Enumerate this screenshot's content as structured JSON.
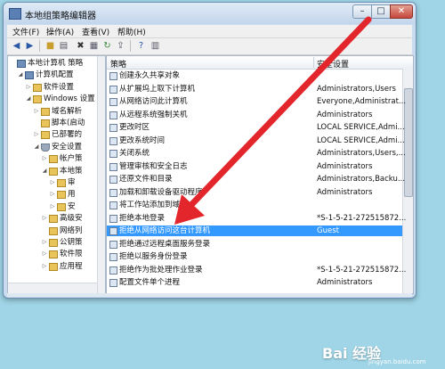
{
  "window": {
    "title": "本地组策略编辑器",
    "controls": {
      "minimize": "–",
      "maximize": "□",
      "close": "✕"
    }
  },
  "menu": [
    "文件(F)",
    "操作(A)",
    "查看(V)",
    "帮助(H)"
  ],
  "toolbar_icons": [
    "back-arrow-icon",
    "forward-arrow-icon",
    "up-folder-icon",
    "show-tree-icon",
    "delete-icon",
    "properties-icon",
    "refresh-icon",
    "export-icon",
    "help-icon",
    "view-icon"
  ],
  "tree": [
    {
      "label": "本地计算机 策略",
      "level": 0,
      "toggle": "",
      "icon": "pc"
    },
    {
      "label": "计算机配置",
      "level": 1,
      "toggle": "◢",
      "icon": "pc"
    },
    {
      "label": "软件设置",
      "level": 2,
      "toggle": "▷",
      "icon": "folder"
    },
    {
      "label": "Windows 设置",
      "level": 2,
      "toggle": "◢",
      "icon": "folder"
    },
    {
      "label": "域名解析",
      "level": 3,
      "toggle": "▷",
      "icon": "folder"
    },
    {
      "label": "脚本(启动",
      "level": 3,
      "toggle": "",
      "icon": "folder"
    },
    {
      "label": "已部署的",
      "level": 3,
      "toggle": "▷",
      "icon": "folder"
    },
    {
      "label": "安全设置",
      "level": 3,
      "toggle": "◢",
      "icon": "shield"
    },
    {
      "label": "帐户策",
      "level": 4,
      "toggle": "▷",
      "icon": "folder"
    },
    {
      "label": "本地策",
      "level": 4,
      "toggle": "◢",
      "icon": "folder"
    },
    {
      "label": "审",
      "level": 5,
      "toggle": "▷",
      "icon": "folder"
    },
    {
      "label": "用",
      "level": 5,
      "toggle": "▷",
      "icon": "folder"
    },
    {
      "label": "安",
      "level": 5,
      "toggle": "▷",
      "icon": "folder"
    },
    {
      "label": "高级安",
      "level": 4,
      "toggle": "▷",
      "icon": "folder"
    },
    {
      "label": "网络列",
      "level": 4,
      "toggle": "",
      "icon": "folder"
    },
    {
      "label": "公钥策",
      "level": 4,
      "toggle": "▷",
      "icon": "folder"
    },
    {
      "label": "软件限",
      "level": 4,
      "toggle": "▷",
      "icon": "folder"
    },
    {
      "label": "应用程",
      "level": 4,
      "toggle": "▷",
      "icon": "folder"
    }
  ],
  "list": {
    "columns": [
      "策略",
      "安全设置"
    ],
    "rows": [
      {
        "name": "创建永久共享对象",
        "setting": ""
      },
      {
        "name": "从扩展坞上取下计算机",
        "setting": "Administrators,Users"
      },
      {
        "name": "从网络访问此计算机",
        "setting": "Everyone,Administrat..."
      },
      {
        "name": "从远程系统强制关机",
        "setting": "Administrators"
      },
      {
        "name": "更改时区",
        "setting": "LOCAL SERVICE,Admi..."
      },
      {
        "name": "更改系统时间",
        "setting": "LOCAL SERVICE,Admi..."
      },
      {
        "name": "关闭系统",
        "setting": "Administrators,Users,..."
      },
      {
        "name": "管理审核和安全日志",
        "setting": "Administrators"
      },
      {
        "name": "还原文件和目录",
        "setting": "Administrators,Backu..."
      },
      {
        "name": "加载和卸载设备驱动程序",
        "setting": "Administrators"
      },
      {
        "name": "将工作站添加到域",
        "setting": ""
      },
      {
        "name": "拒绝本地登录",
        "setting": "*S-1-5-21-272515872..."
      },
      {
        "name": "拒绝从网络访问这台计算机",
        "setting": "Guest",
        "selected": true
      },
      {
        "name": "拒绝通过远程桌面服务登录",
        "setting": ""
      },
      {
        "name": "拒绝以服务身份登录",
        "setting": ""
      },
      {
        "name": "拒绝作为批处理作业登录",
        "setting": "*S-1-5-21-272515872..."
      },
      {
        "name": "配置文件单个进程",
        "setting": "Administrators"
      }
    ]
  },
  "watermark": {
    "brand": "Bai 经验",
    "url": "jingyan.baidu.com"
  },
  "colors": {
    "selection": "#3399ff",
    "arrow": "#e3262b",
    "desktop": "#9fd5e6"
  }
}
